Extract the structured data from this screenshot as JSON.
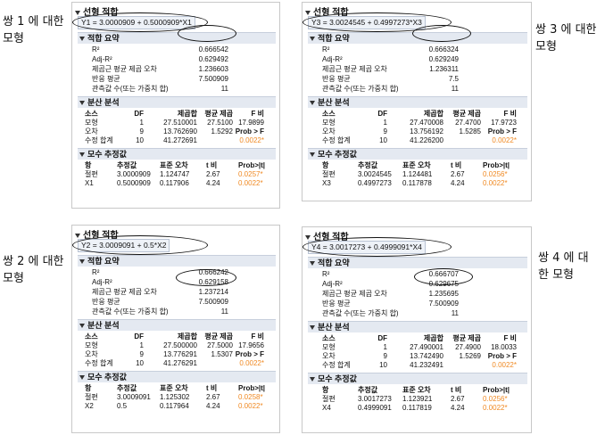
{
  "labels": {
    "pair1_line1": "쌍 1 에 대한",
    "pair1_line2": "모형",
    "pair2_line1": "쌍 2 에 대한",
    "pair2_line2": "모형",
    "pair3_line1": "쌍 3 에 대한",
    "pair3_line2": "모형",
    "pair4_line1": "쌍 4 에 대",
    "pair4_line2": "한 모형"
  },
  "panels": [
    {
      "title": "선형 적합",
      "equation": "Y1 = 3.0000909 + 0.5000909*X1",
      "summary_header": "적합 요약",
      "summary": [
        {
          "label": "R²",
          "value": "0.666542"
        },
        {
          "label": "Adj-R²",
          "value": "0.629492"
        },
        {
          "label": "제곱근 평균 제곱 오차",
          "value": "1.236603"
        },
        {
          "label": "반응 평균",
          "value": "7.500909"
        },
        {
          "label": "관측값 수(또는 가중치 합)",
          "value": "11"
        }
      ],
      "anova_header": "분산 분석",
      "anova_cols": [
        "소스",
        "DF",
        "제곱합",
        "평균 제곱",
        "F 비"
      ],
      "anova_rows": [
        {
          "src": "모형",
          "df": "1",
          "ss": "27.510001",
          "ms": "27.5100",
          "f": "17.9899"
        },
        {
          "src": "오차",
          "df": "9",
          "ss": "13.762690",
          "ms": "1.5292",
          "f": "Prob > F"
        },
        {
          "src": "수정 합계",
          "df": "10",
          "ss": "41.272691",
          "ms": "",
          "f": "0.0022*"
        }
      ],
      "param_header": "모수 추정값",
      "param_cols": [
        "항",
        "추정값",
        "표준 오차",
        "t 비",
        "Prob>|t|"
      ],
      "param_rows": [
        {
          "term": "절편",
          "est": "3.0000909",
          "se": "1.124747",
          "t": "2.67",
          "p": "0.0257*"
        },
        {
          "term": "X1",
          "est": "0.5000909",
          "se": "0.117906",
          "t": "4.24",
          "p": "0.0022*"
        }
      ]
    },
    {
      "title": "선형 적합",
      "equation": "Y3 = 3.0024545 + 0.4997273*X3",
      "summary_header": "적합 요약",
      "summary": [
        {
          "label": "R²",
          "value": "0.666324"
        },
        {
          "label": "Adj-R²",
          "value": "0.629249"
        },
        {
          "label": "제곱근 평균 제곱 오차",
          "value": "1.236311"
        },
        {
          "label": "반응 평균",
          "value": "7.5"
        },
        {
          "label": "관측값 수(또는 가중치 합)",
          "value": "11"
        }
      ],
      "anova_header": "분산 분석",
      "anova_cols": [
        "소스",
        "DF",
        "제곱합",
        "평균 제곱",
        "F 비"
      ],
      "anova_rows": [
        {
          "src": "모형",
          "df": "1",
          "ss": "27.470008",
          "ms": "27.4700",
          "f": "17.9723"
        },
        {
          "src": "오차",
          "df": "9",
          "ss": "13.756192",
          "ms": "1.5285",
          "f": "Prob > F"
        },
        {
          "src": "수정 합계",
          "df": "10",
          "ss": "41.226200",
          "ms": "",
          "f": "0.0022*"
        }
      ],
      "param_header": "모수 추정값",
      "param_cols": [
        "항",
        "추정값",
        "표준 오차",
        "t 비",
        "Prob>|t|"
      ],
      "param_rows": [
        {
          "term": "절편",
          "est": "3.0024545",
          "se": "1.124481",
          "t": "2.67",
          "p": "0.0256*"
        },
        {
          "term": "X3",
          "est": "0.4997273",
          "se": "0.117878",
          "t": "4.24",
          "p": "0.0022*"
        }
      ]
    },
    {
      "title": "선형 적합",
      "equation": "Y2 = 3.0009091 + 0.5*X2",
      "summary_header": "적합 요약",
      "summary": [
        {
          "label": "R²",
          "value": "0.666242"
        },
        {
          "label": "Adj-R²",
          "value": "0.629158"
        },
        {
          "label": "제곱근 평균 제곱 오차",
          "value": "1.237214"
        },
        {
          "label": "반응 평균",
          "value": "7.500909"
        },
        {
          "label": "관측값 수(또는 가중치 합)",
          "value": "11"
        }
      ],
      "anova_header": "분산 분석",
      "anova_cols": [
        "소스",
        "DF",
        "제곱합",
        "평균 제곱",
        "F 비"
      ],
      "anova_rows": [
        {
          "src": "모형",
          "df": "1",
          "ss": "27.500000",
          "ms": "27.5000",
          "f": "17.9656"
        },
        {
          "src": "오차",
          "df": "9",
          "ss": "13.776291",
          "ms": "1.5307",
          "f": "Prob > F"
        },
        {
          "src": "수정 합계",
          "df": "10",
          "ss": "41.276291",
          "ms": "",
          "f": "0.0022*"
        }
      ],
      "param_header": "모수 추정값",
      "param_cols": [
        "항",
        "추정값",
        "표준 오차",
        "t 비",
        "Prob>|t|"
      ],
      "param_rows": [
        {
          "term": "절편",
          "est": "3.0009091",
          "se": "1.125302",
          "t": "2.67",
          "p": "0.0258*"
        },
        {
          "term": "X2",
          "est": "0.5",
          "se": "0.117964",
          "t": "4.24",
          "p": "0.0022*"
        }
      ]
    },
    {
      "title": "선형 적합",
      "equation": "Y4 = 3.0017273 + 0.4999091*X4",
      "summary_header": "적합 요약",
      "summary": [
        {
          "label": "R²",
          "value": "0.666707"
        },
        {
          "label": "Adj-R²",
          "value": "0.629675"
        },
        {
          "label": "제곱근 평균 제곱 오차",
          "value": "1.235695"
        },
        {
          "label": "반응 평균",
          "value": "7.500909"
        },
        {
          "label": "관측값 수(또는 가중치 합)",
          "value": "11"
        }
      ],
      "anova_header": "분산 분석",
      "anova_cols": [
        "소스",
        "DF",
        "제곱합",
        "평균 제곱",
        "F 비"
      ],
      "anova_rows": [
        {
          "src": "모형",
          "df": "1",
          "ss": "27.490001",
          "ms": "27.4900",
          "f": "18.0033"
        },
        {
          "src": "오차",
          "df": "9",
          "ss": "13.742490",
          "ms": "1.5269",
          "f": "Prob > F"
        },
        {
          "src": "수정 합계",
          "df": "10",
          "ss": "41.232491",
          "ms": "",
          "f": "0.0022*"
        }
      ],
      "param_header": "모수 추정값",
      "param_cols": [
        "항",
        "추정값",
        "표준 오차",
        "t 비",
        "Prob>|t|"
      ],
      "param_rows": [
        {
          "term": "절편",
          "est": "3.0017273",
          "se": "1.123921",
          "t": "2.67",
          "p": "0.0256*"
        },
        {
          "term": "X4",
          "est": "0.4999091",
          "se": "0.117819",
          "t": "4.24",
          "p": "0.0022*"
        }
      ]
    }
  ]
}
